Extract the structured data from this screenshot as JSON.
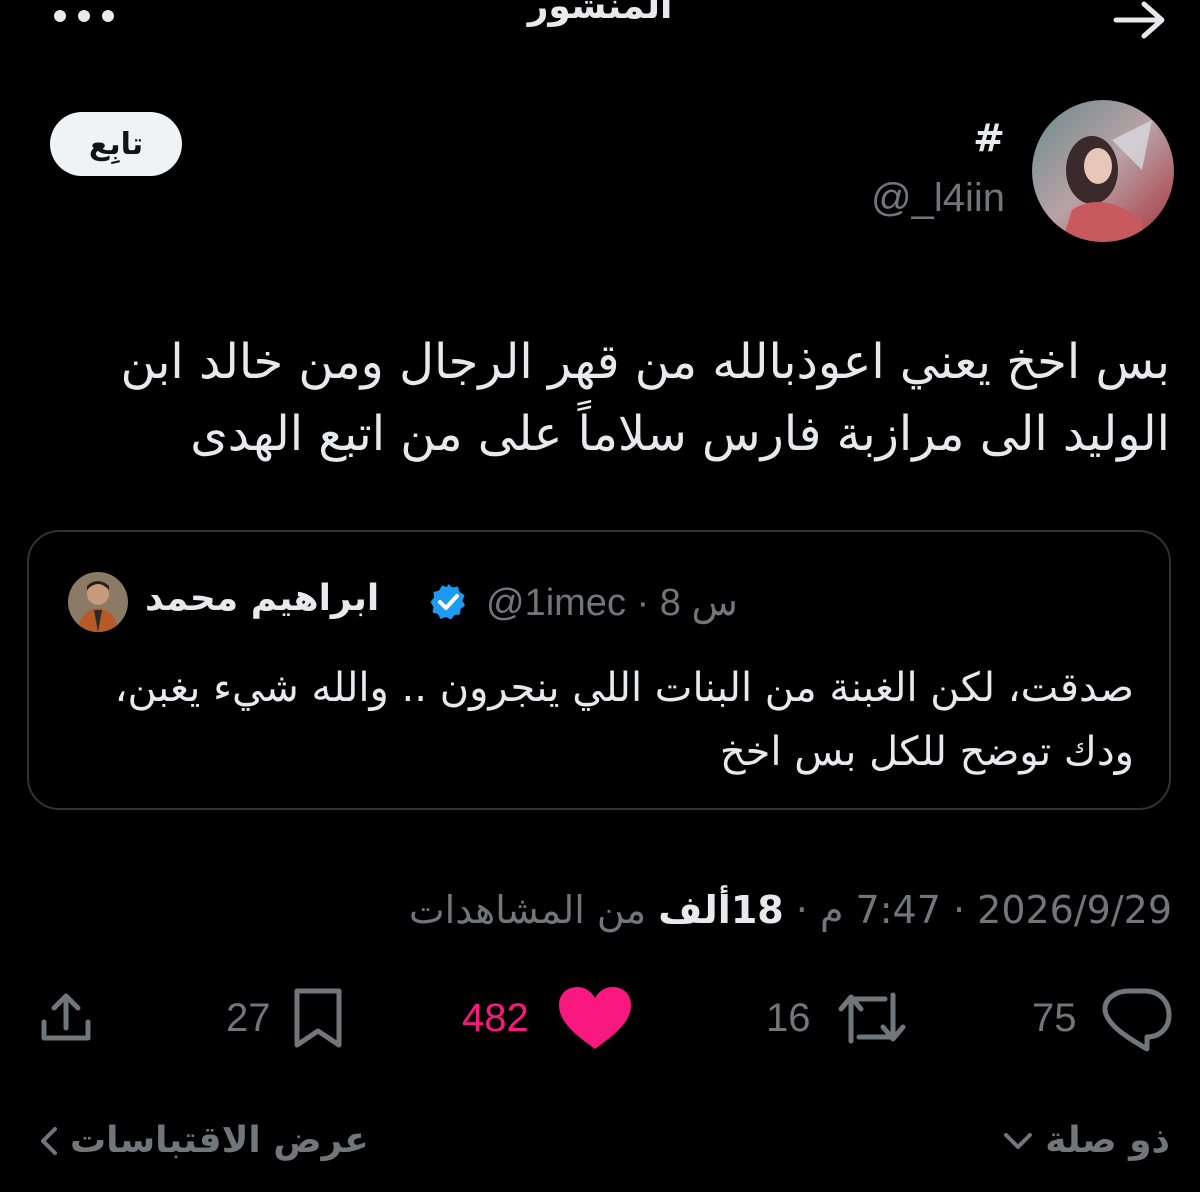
{
  "header": {
    "title": "المنشور",
    "back_icon": "arrow-right-icon",
    "more_icon": "more-dots-icon"
  },
  "author": {
    "display_name": "#",
    "handle": "@_l4iin",
    "follow_label": "تابِع"
  },
  "tweet": {
    "text": "بس اخخ يعني اعوذبالله من قهر الرجال ومن خالد ابن الوليد الى مرازبة فارس سلاماً على من اتبع الهدى"
  },
  "quote": {
    "name": "ابراهيم محمد",
    "handle": "@1imec",
    "time": "8 س",
    "text": "صدقت، لكن الغبنة من البنات اللي ينجرون .. والله شيء يغبن، ودك توضح للكل بس اخخ"
  },
  "meta": {
    "date": "2026/9/29",
    "time": "7:47 م",
    "views_count": "18ألف",
    "views_label": "من المشاهدات"
  },
  "actions": {
    "replies": "75",
    "retweets": "16",
    "likes": "482",
    "bookmarks": "27"
  },
  "bottom": {
    "related_label": "ذو صلة",
    "quotes_label": "عرض الاقتباسات"
  },
  "colors": {
    "background": "#000000",
    "text": "#e7e9ea",
    "muted": "#71767b",
    "like": "#f91880",
    "verified": "#1d9bf0",
    "border": "#2f3336"
  }
}
